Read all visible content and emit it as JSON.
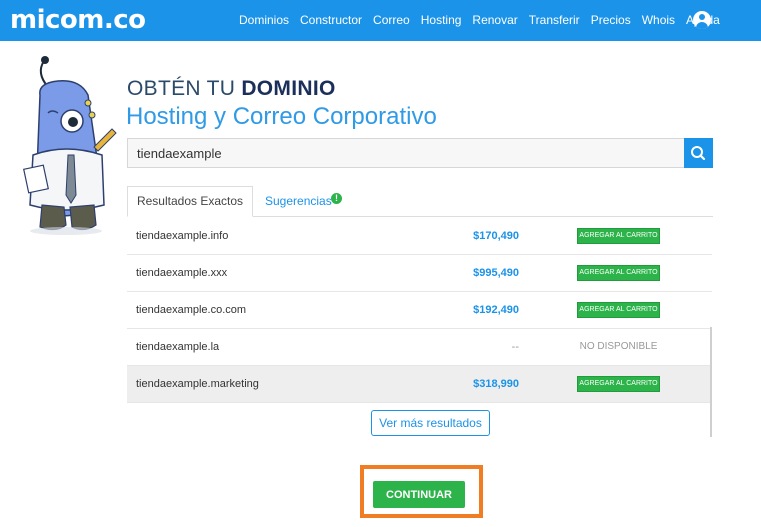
{
  "brand": {
    "logo": "micom.co",
    "accent": "#1b93e8",
    "success": "#2cb34a",
    "highlight": "#f07d24"
  },
  "nav": {
    "items": [
      "Dominios",
      "Constructor",
      "Correo",
      "Hosting",
      "Renovar",
      "Transferir",
      "Precios",
      "Whois",
      "Ayuda"
    ],
    "user_icon": "user-circle-icon"
  },
  "heading": {
    "title_prefix": "OBTÉN TU ",
    "title_bold": "DOMINIO",
    "subtitle": "Hosting y Correo Corporativo"
  },
  "search": {
    "value": "tiendaexample",
    "icon": "search-icon"
  },
  "tabs": {
    "exact": "Resultados Exactos",
    "suggestions": "Sugerencias",
    "badge": "!"
  },
  "results": [
    {
      "domain": "tiendaexample.info",
      "price": "$170,490",
      "action": "AGREGAR AL CARRITO"
    },
    {
      "domain": "tiendaexample.xxx",
      "price": "$995,490",
      "action": "AGREGAR AL CARRITO"
    },
    {
      "domain": "tiendaexample.co.com",
      "price": "$192,490",
      "action": "AGREGAR AL CARRITO"
    },
    {
      "domain": "tiendaexample.la",
      "price": "--",
      "status": "NO DISPONIBLE"
    },
    {
      "domain": "tiendaexample.marketing",
      "price": "$318,990",
      "action": "AGREGAR AL CARRITO"
    }
  ],
  "more_results": "Ver más resultados",
  "continue": "CONTINUAR"
}
